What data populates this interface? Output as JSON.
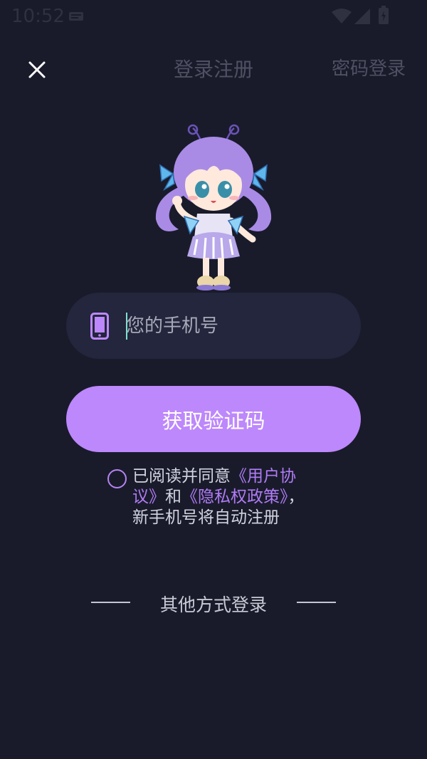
{
  "status_bar": {
    "time": "10:52",
    "icons": [
      "notification-icon",
      "wifi-icon",
      "signal-icon",
      "battery-icon"
    ]
  },
  "header": {
    "title": "登录注册",
    "password_login": "密码登录",
    "close_icon": "close-icon"
  },
  "mascot": {
    "name": "chibi-fairy-girl-illustration"
  },
  "phone_input": {
    "placeholder": "您的手机号",
    "value": "",
    "icon": "phone-icon"
  },
  "get_code_button": {
    "label": "获取验证码"
  },
  "agreement": {
    "checked": false,
    "text_before": "已阅读并同意",
    "user_agreement_link": "《用户协议》",
    "connector": "和",
    "privacy_policy_link": "《隐私权政策》",
    "text_after": "，新手机号将自动注册"
  },
  "other_login": {
    "label": "其他方式登录"
  },
  "colors": {
    "background": "#191b2b",
    "accent": "#bd88fb",
    "link": "#b07bf5",
    "input_background": "#23263c"
  }
}
